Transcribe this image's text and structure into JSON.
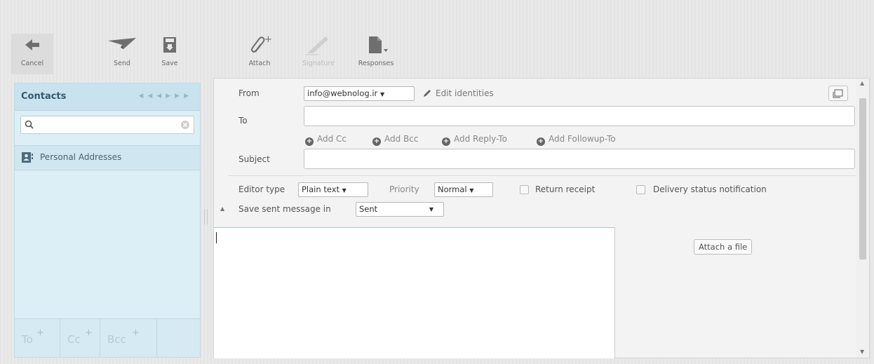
{
  "toolbar": {
    "cancel": "Cancel",
    "send": "Send",
    "save": "Save",
    "attach": "Attach",
    "signature": "Signature",
    "responses": "Responses"
  },
  "contacts": {
    "title": "Contacts",
    "search_value": "",
    "addressbook": "Personal Addresses",
    "footer": {
      "to": "To",
      "cc": "Cc",
      "bcc": "Bcc"
    }
  },
  "compose": {
    "from_label": "From",
    "from_value": "info@webnolog.ir",
    "edit_identities": "Edit identities",
    "to_label": "To",
    "add_cc": "Add Cc",
    "add_bcc": "Add Bcc",
    "add_reply_to": "Add Reply-To",
    "add_followup_to": "Add Followup-To",
    "subject_label": "Subject",
    "editor_type_label": "Editor type",
    "editor_type_value": "Plain text",
    "priority_label": "Priority",
    "priority_value": "Normal",
    "return_receipt": "Return receipt",
    "delivery_status": "Delivery status notification",
    "save_sent_label": "Save sent message in",
    "save_sent_value": "Sent",
    "attach_file": "Attach a file"
  },
  "icons": {
    "cancel": "arrow-left-icon",
    "send": "paper-plane-icon",
    "save": "save-icon",
    "attach": "paperclip-plus-icon",
    "signature": "pen-icon",
    "responses": "document-dropdown-icon"
  }
}
